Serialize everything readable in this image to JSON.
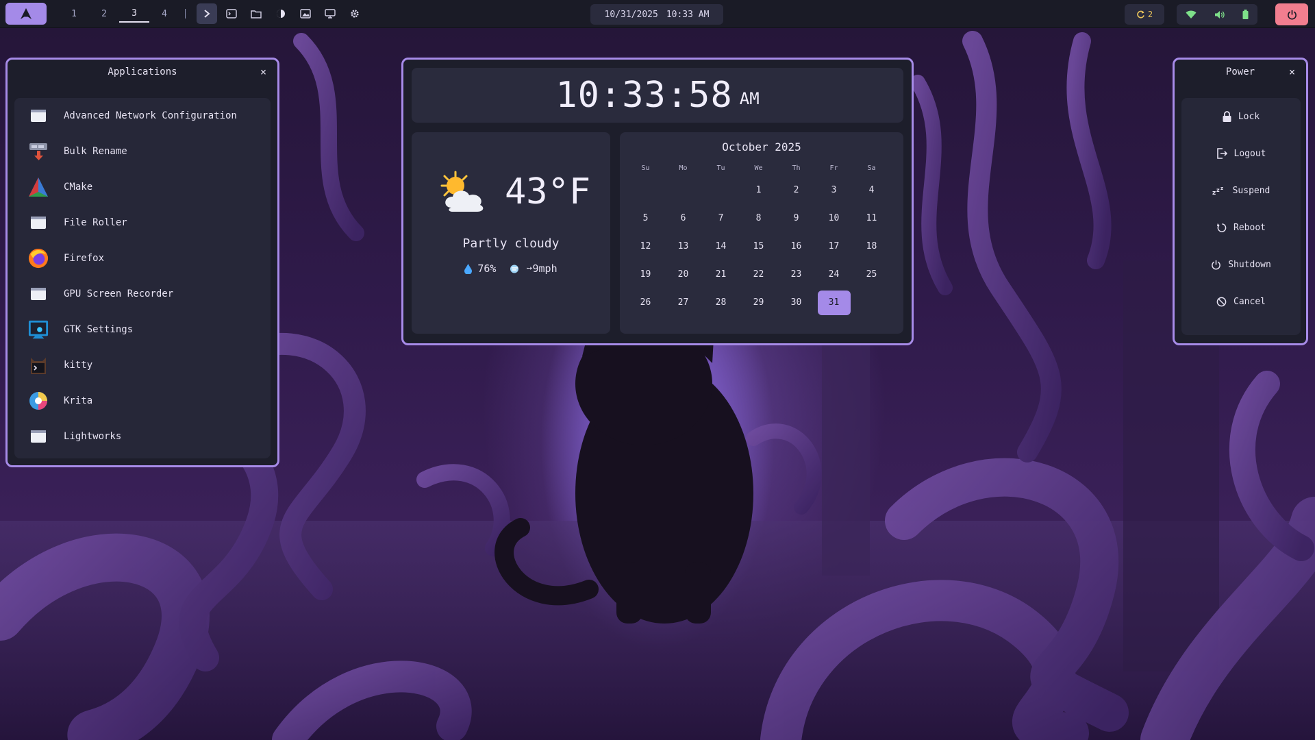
{
  "topbar": {
    "workspaces": [
      "1",
      "2",
      "3",
      "4"
    ],
    "active_workspace": "3",
    "date": "10/31/2025",
    "time": "10:33 AM",
    "updates_count": "2",
    "icons": [
      "arch-logo-icon",
      "chevron-right-icon",
      "terminal-icon",
      "folder-icon",
      "theme-icon",
      "image-icon",
      "monitor-icon",
      "gear-icon",
      "refresh-icon",
      "wifi-icon",
      "volume-icon",
      "battery-icon",
      "power-icon"
    ]
  },
  "apps_panel": {
    "title": "Applications",
    "close": "×",
    "items": [
      {
        "label": "Advanced Network Configuration",
        "icon": "window-icon"
      },
      {
        "label": "Bulk Rename",
        "icon": "bulk-rename-icon"
      },
      {
        "label": "CMake",
        "icon": "cmake-icon"
      },
      {
        "label": "File Roller",
        "icon": "window-icon"
      },
      {
        "label": "Firefox",
        "icon": "firefox-icon"
      },
      {
        "label": "GPU Screen Recorder",
        "icon": "window-icon"
      },
      {
        "label": "GTK Settings",
        "icon": "gtk-settings-icon"
      },
      {
        "label": "kitty",
        "icon": "kitty-icon"
      },
      {
        "label": "Krita",
        "icon": "krita-icon"
      },
      {
        "label": "Lightworks",
        "icon": "window-icon"
      }
    ]
  },
  "clock": {
    "time": "10:33:58",
    "ampm": "AM"
  },
  "weather": {
    "temperature": "43°F",
    "condition": "Partly cloudy",
    "humidity": "76%",
    "wind": "➙9mph",
    "icon": "partly-cloudy-icon"
  },
  "calendar": {
    "title": "October 2025",
    "weekdays": [
      "Su",
      "Mo",
      "Tu",
      "We",
      "Th",
      "Fr",
      "Sa"
    ],
    "days": [
      "",
      "",
      "",
      "1",
      "2",
      "3",
      "4",
      "5",
      "6",
      "7",
      "8",
      "9",
      "10",
      "11",
      "12",
      "13",
      "14",
      "15",
      "16",
      "17",
      "18",
      "19",
      "20",
      "21",
      "22",
      "23",
      "24",
      "25",
      "26",
      "27",
      "28",
      "29",
      "30",
      "31",
      ""
    ],
    "today": "31"
  },
  "power_panel": {
    "title": "Power",
    "close": "×",
    "items": [
      {
        "label": "Lock",
        "icon": "lock-icon"
      },
      {
        "label": "Logout",
        "icon": "logout-icon"
      },
      {
        "label": "Suspend",
        "icon": "sleep-icon"
      },
      {
        "label": "Reboot",
        "icon": "reboot-icon"
      },
      {
        "label": "Shutdown",
        "icon": "shutdown-icon"
      },
      {
        "label": "Cancel",
        "icon": "cancel-icon"
      }
    ]
  },
  "colors": {
    "accent": "#a48ae8",
    "bar": "#1a1b26",
    "panel": "#1d1e2b",
    "card": "#2a2b3d",
    "power_button": "#f27e8f",
    "updates": "#e8c25a",
    "wifi": "#7ee08a"
  }
}
